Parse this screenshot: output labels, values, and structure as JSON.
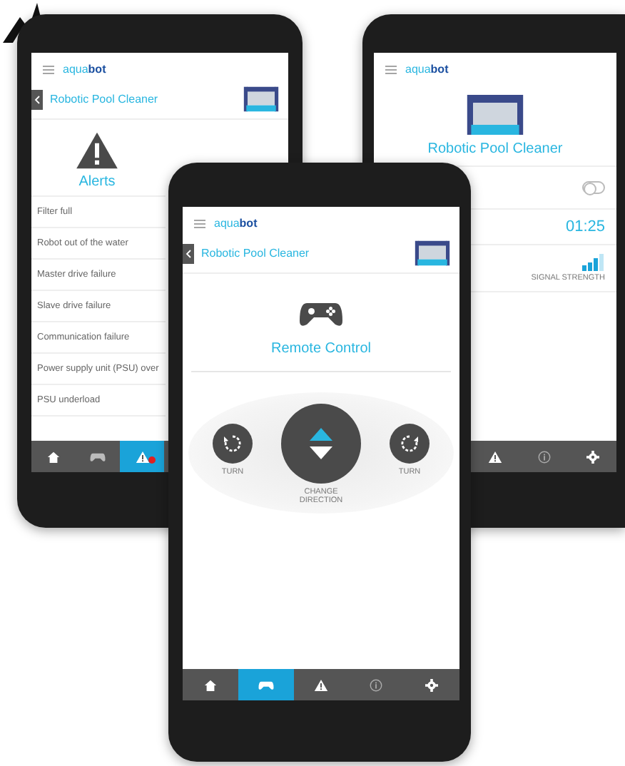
{
  "phones": [
    {
      "kind": "alerts",
      "logo": "aqua**bot**",
      "title": "Robotic Pool Cleaner",
      "heading": "Alerts",
      "alerts": [
        "Filter full",
        "Robot out of the water",
        "Master drive failure",
        "Slave drive failure",
        "Communication failure",
        "Power supply unit (PSU) over",
        "PSU underload"
      ],
      "tabs": [
        {
          "kind": "home",
          "selected": false
        },
        {
          "kind": "gamepad",
          "selected": false
        },
        {
          "kind": "alert",
          "selected": true,
          "badge": true
        }
      ]
    },
    {
      "kind": "status",
      "logo": "aqua**bot**",
      "title": "Robotic Pool Cleaner",
      "toggle": {
        "on": false
      },
      "time": "01:25",
      "signal_label": "SIGNAL STRENGTH",
      "tabs": [
        {
          "kind": "alert",
          "selected": false
        },
        {
          "kind": "info",
          "selected": false
        },
        {
          "kind": "settings",
          "selected": false
        }
      ]
    },
    {
      "kind": "remote",
      "logo": "aqua**bot**",
      "title": "Robotic Pool Cleaner",
      "heading": "Remote Control",
      "controls": [
        {
          "kind": "turn_left",
          "label": "TURN"
        },
        {
          "kind": "change_direction",
          "label": "CHANGE DIRECTION"
        },
        {
          "kind": "turn_right",
          "label": "TURN"
        }
      ],
      "tabs": [
        {
          "kind": "home",
          "selected": false
        },
        {
          "kind": "gamepad",
          "selected": true
        },
        {
          "kind": "alert",
          "selected": false
        },
        {
          "kind": "info",
          "selected": false
        },
        {
          "kind": "settings",
          "selected": false
        }
      ]
    }
  ]
}
